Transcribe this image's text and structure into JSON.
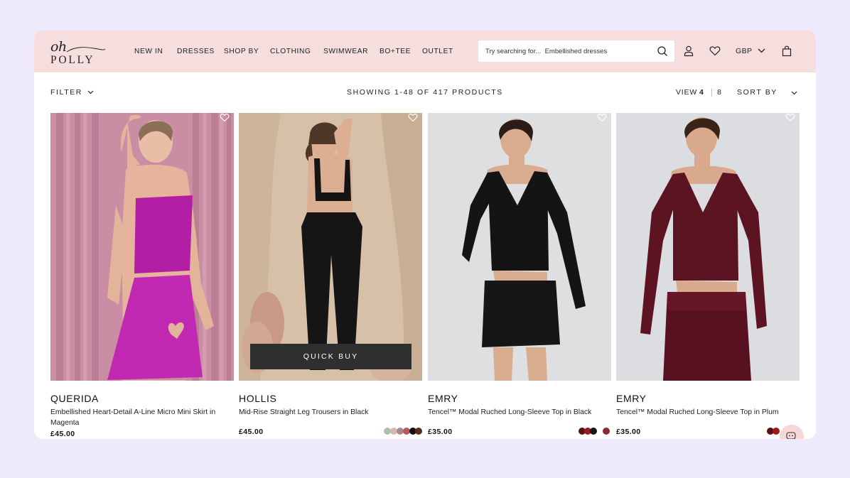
{
  "brand": {
    "oh": "oh",
    "polly": "POLLY"
  },
  "nav": [
    "NEW IN",
    "DRESSES",
    "SHOP BY",
    "CLOTHING",
    "SWIMWEAR",
    "BO+TEE",
    "OUTLET"
  ],
  "search": {
    "placeholder": "Try searching for...  Embellished dresses"
  },
  "header": {
    "currency": "GBP"
  },
  "toolbar": {
    "filter_label": "FILTER",
    "showing_text": "SHOWING 1-48 OF 417 PRODUCTS",
    "view_label": "VIEW",
    "view_options": [
      "4",
      "8"
    ],
    "view_selected": "4",
    "sort_label": "SORT BY"
  },
  "quick_buy_label": "QUICK BUY",
  "products": [
    {
      "name": "QUERIDA",
      "description": "Embellished Heart-Detail A-Line Micro Mini Skirt in Magenta",
      "price": "£45.00",
      "swatches": []
    },
    {
      "name": "HOLLIS",
      "description": "Mid-Rise Straight Leg Trousers in Black",
      "price": "£45.00",
      "swatches": [
        "#a9c3a6",
        "#d8b7b0",
        "#a88a8c",
        "#b45a5a",
        "#111111",
        "#5a2c18"
      ]
    },
    {
      "name": "EMRY",
      "description": "Tencel™ Modal Ruched Long-Sleeve Top in Black",
      "price": "£35.00",
      "swatches": [
        "#5a1018",
        "#9a1a1a",
        "#151515",
        "#8b2a34"
      ]
    },
    {
      "name": "EMRY",
      "description": "Tencel™ Modal Ruched Long-Sleeve Top in Plum",
      "price": "£35.00",
      "swatches": [
        "#5a1018",
        "#a01a1a"
      ]
    }
  ],
  "colors": {
    "page_bg": "#efeafb",
    "header_bg": "#f6dede",
    "quick_buy_bg": "#2f2f2f"
  }
}
